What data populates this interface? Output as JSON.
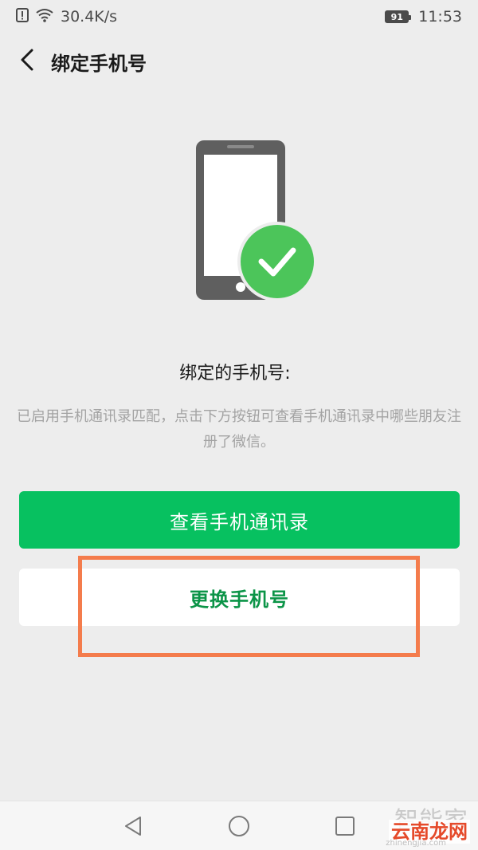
{
  "status_bar": {
    "network_speed": "30.4K/s",
    "battery": "91",
    "time": "11:53",
    "icons": [
      "alert-icon",
      "wifi-icon",
      "battery-icon"
    ]
  },
  "nav": {
    "title": "绑定手机号",
    "back_icon": "chevron-left-icon"
  },
  "illustration": {
    "icon": "phone-check-icon",
    "phone_color": "#5f5f5f",
    "check_color": "#4cc55a"
  },
  "content": {
    "bound_label": "绑定的手机号:",
    "description": "已启用手机通讯录匹配，点击下方按钮可查看手机通讯录中哪些朋友注册了微信。"
  },
  "buttons": {
    "view_contacts": "查看手机通讯录",
    "change_phone": "更换手机号"
  },
  "colors": {
    "primary_green": "#07c160",
    "secondary_text_green": "#0b9447",
    "highlight_orange": "#f47c4c"
  },
  "system_nav": {
    "icons": [
      "back-triangle-icon",
      "home-circle-icon",
      "recents-square-icon"
    ]
  },
  "watermark": {
    "top": "智能家",
    "main": "云南龙网",
    "sub": "zhinengjia.com"
  }
}
